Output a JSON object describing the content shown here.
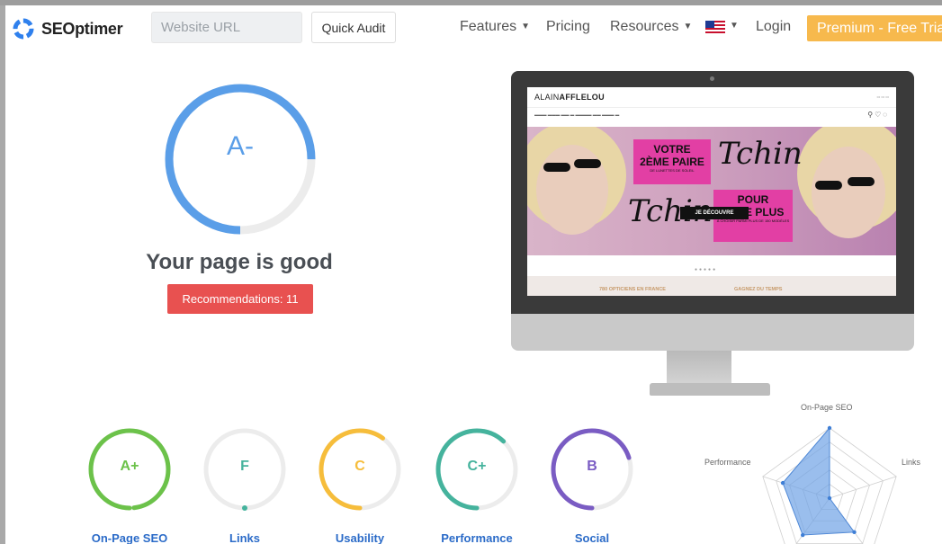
{
  "header": {
    "logo_text": "SEOptimer",
    "url_placeholder": "Website URL",
    "quick_audit_label": "Quick Audit",
    "nav": {
      "features": "Features",
      "pricing": "Pricing",
      "resources": "Resources",
      "login": "Login"
    },
    "premium_label": "Premium - Free Trial"
  },
  "grade": {
    "letter": "A-",
    "progress_fraction": 0.75,
    "color": "#5a9ee8",
    "summary": "Your page is good",
    "recommendations_label": "Recommendations: 11"
  },
  "preview": {
    "site_logo_part1": "ALAIN",
    "site_logo_part2": "AFFLELOU",
    "promo1_line1": "VOTRE",
    "promo1_line2": "2ÈME PAIRE",
    "promo1_line3": "DE LUNETTES DE SOLEIL",
    "promo2_line1": "POUR",
    "promo2_line2": "1€ DE PLUS",
    "promo2_line3": "À CHOISIR PARMI PLUS DE 150 MODÈLES",
    "tchin_1": "Tchin",
    "tchin_2": "Tchin",
    "cta": "JE DÉCOUVRE",
    "strip_text1": "780 OPTICIENS EN FRANCE",
    "strip_text2": "GAGNEZ DU TEMPS"
  },
  "scores": [
    {
      "label": "On-Page SEO",
      "grade": "A+",
      "fraction": 0.98,
      "color": "#6cc24a"
    },
    {
      "label": "Links",
      "grade": "F",
      "fraction": 0.0,
      "color": "#45b39d"
    },
    {
      "label": "Usability",
      "grade": "C",
      "fraction": 0.6,
      "color": "#f6bd3b"
    },
    {
      "label": "Performance",
      "grade": "C+",
      "fraction": 0.62,
      "color": "#45b39d"
    },
    {
      "label": "Social",
      "grade": "B",
      "fraction": 0.7,
      "color": "#7a5cc3"
    }
  ],
  "radar": {
    "axes": [
      "On-Page SEO",
      "Links",
      "",
      "",
      "Performance"
    ],
    "fill_color": "#6fa3e6",
    "values": [
      1.0,
      0.0,
      0.6,
      0.65,
      0.7
    ]
  }
}
